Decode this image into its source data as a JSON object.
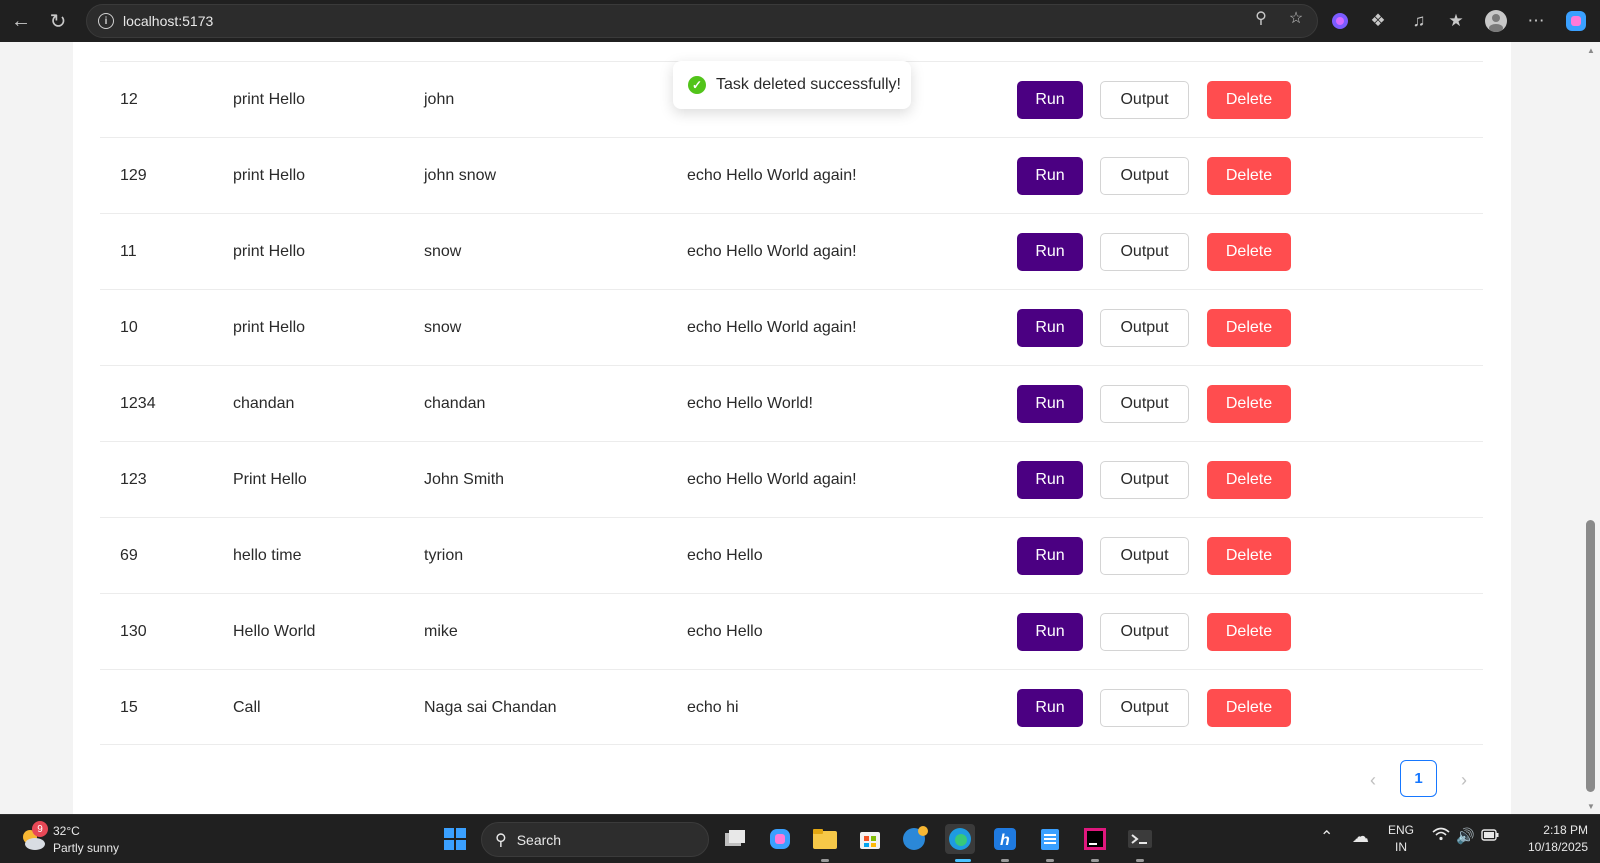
{
  "browser": {
    "url": "localhost:5173"
  },
  "toast": {
    "message": "Task deleted successfully!"
  },
  "table": {
    "rows": [
      {
        "id": "12",
        "name": "print Hello",
        "owner": "john",
        "command": ""
      },
      {
        "id": "129",
        "name": "print Hello",
        "owner": "john snow",
        "command": "echo Hello World again!"
      },
      {
        "id": "11",
        "name": "print Hello",
        "owner": "snow",
        "command": "echo Hello World again!"
      },
      {
        "id": "10",
        "name": "print Hello",
        "owner": "snow",
        "command": "echo Hello World again!"
      },
      {
        "id": "1234",
        "name": "chandan",
        "owner": "chandan",
        "command": "echo Hello World!"
      },
      {
        "id": "123",
        "name": "Print Hello",
        "owner": "John Smith",
        "command": "echo Hello World again!"
      },
      {
        "id": "69",
        "name": "hello time",
        "owner": "tyrion",
        "command": "echo Hello"
      },
      {
        "id": "130",
        "name": "Hello World",
        "owner": "mike",
        "command": "echo Hello"
      },
      {
        "id": "15",
        "name": "Call",
        "owner": "Naga sai Chandan",
        "command": "echo hi"
      }
    ],
    "actions": {
      "run_label": "Run",
      "output_label": "Output",
      "delete_label": "Delete"
    }
  },
  "pagination": {
    "current_page": "1",
    "prev_icon": "chevron-left-icon",
    "next_icon": "chevron-right-icon"
  },
  "colors": {
    "run": "#4b0082",
    "delete": "#ff4d4f",
    "toast_success": "#52c41a",
    "pagination_active": "#1677ff"
  },
  "taskbar": {
    "weather_temp": "32°C",
    "weather_desc": "Partly sunny",
    "weather_badge": "9",
    "search_label": "Search",
    "lang_top": "ENG",
    "lang_bottom": "IN",
    "time": "2:18 PM",
    "date": "10/18/2025"
  }
}
